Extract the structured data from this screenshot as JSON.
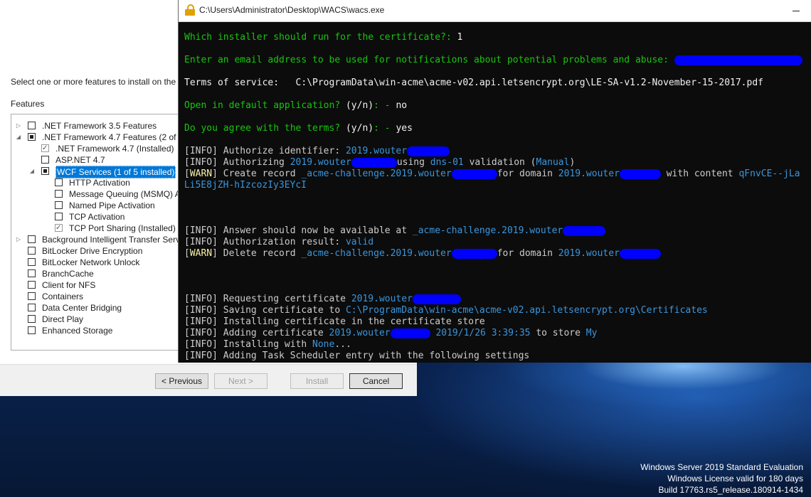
{
  "desktop": {
    "watermark": {
      "line1": "Windows Server 2019 Standard Evaluation",
      "line2": "Windows License valid for 180 days",
      "line3": "Build 17763.rs5_release.180914-1434"
    }
  },
  "wizard": {
    "instruction": "Select one or more features to install on the",
    "features_heading": "Features",
    "tree": [
      {
        "label": ".NET Framework 3.5 Features",
        "state": "unchecked",
        "expander": "collapsed"
      },
      {
        "label": ".NET Framework 4.7 Features (2 of 7",
        "state": "partial",
        "expander": "expanded"
      },
      {
        "label": ".NET Framework 4.7 (Installed)",
        "state": "checked-disabled"
      },
      {
        "label": "ASP.NET 4.7",
        "state": "unchecked"
      },
      {
        "label": "WCF Services (1 of 5 installed)",
        "state": "partial",
        "expander": "expanded",
        "selected": true
      },
      {
        "label": "HTTP Activation",
        "state": "unchecked"
      },
      {
        "label": "Message Queuing (MSMQ) A",
        "state": "unchecked"
      },
      {
        "label": "Named Pipe Activation",
        "state": "unchecked"
      },
      {
        "label": "TCP Activation",
        "state": "unchecked"
      },
      {
        "label": "TCP Port Sharing (Installed)",
        "state": "checked-disabled"
      },
      {
        "label": "Background Intelligent Transfer Serv",
        "state": "unchecked",
        "expander": "collapsed"
      },
      {
        "label": "BitLocker Drive Encryption",
        "state": "unchecked"
      },
      {
        "label": "BitLocker Network Unlock",
        "state": "unchecked"
      },
      {
        "label": "BranchCache",
        "state": "unchecked"
      },
      {
        "label": "Client for NFS",
        "state": "unchecked"
      },
      {
        "label": "Containers",
        "state": "unchecked"
      },
      {
        "label": "Data Center Bridging",
        "state": "unchecked"
      },
      {
        "label": "Direct Play",
        "state": "unchecked"
      },
      {
        "label": "Enhanced Storage",
        "state": "unchecked"
      }
    ],
    "buttons": {
      "previous": "< Previous",
      "next": "Next >",
      "install": "Install",
      "cancel": "Cancel"
    }
  },
  "console": {
    "title": "C:\\Users\\Administrator\\Desktop\\WACS\\wacs.exe",
    "lines": {
      "l1_prompt": "Which installer should run for the certificate?: ",
      "l1_answer": "1",
      "l2_prompt": "Enter an email address to be used for notifications about potential problems and abuse: ",
      "l2_answer": "",
      "l3_label": "Terms of service:   ",
      "l3_path": "C:\\ProgramData\\win-acme\\acme-v02.api.letsencrypt.org\\LE-SA-v1.2-November-15-2017.pdf",
      "l4_prompt": "Open in default application? ",
      "l4_yn": "(y/n)",
      "l4_sep": ": - ",
      "l4_answer": "no",
      "l5_prompt": "Do you agree with the terms? ",
      "l5_yn": "(y/n)",
      "l5_sep": ": - ",
      "l5_answer": "yes",
      "info": "INFO",
      "warn": "WARN",
      "l6_text": " Authorize identifier: ",
      "l6_host": "2019.wouter",
      "l7_text": " Authorizing ",
      "l7_host": "2019.wouter",
      "l7_using": "using ",
      "l7_method": "dns-01",
      "l7_validation": " validation (",
      "l7_manual": "Manual",
      "l7_close": ")",
      "l8_text": " Create record ",
      "l8_record": "_acme-challenge.2019.wouter",
      "l8_for": "for domain ",
      "l8_domain": "2019.wouter",
      "l8_with": " with content ",
      "l8_content": "qFnvCE--jLa",
      "l9_content": "QLi5E8jZH-hIzcozIy3EYcI",
      "l10_text": " Answer should now be available at ",
      "l10_record": "_acme-challenge.2019.wouter",
      "l11_text": " Authorization result: ",
      "l11_result": "valid",
      "l12_text": " Delete record ",
      "l12_record": "_acme-challenge.2019.wouter",
      "l12_for": "for domain ",
      "l12_domain": "2019.wouter",
      "l13_text": " Requesting certificate ",
      "l13_host": "2019.wouter",
      "l14_text": " Saving certificate to ",
      "l14_path": "C:\\ProgramData\\win-acme\\acme-v02.api.letsencrypt.org\\Certificates",
      "l15_text": " Installing certificate in the certificate store",
      "l16_text": " Adding certificate ",
      "l16_host": "2019.wouter",
      "l16_date": "2019/1/26 3:39:35",
      "l16_to": " to store ",
      "l16_store": "My",
      "l17_text": " Installing with ",
      "l17_value": "None",
      "l17_dots": "...",
      "l18_text": " Adding Task Scheduler entry with the following settings"
    }
  }
}
